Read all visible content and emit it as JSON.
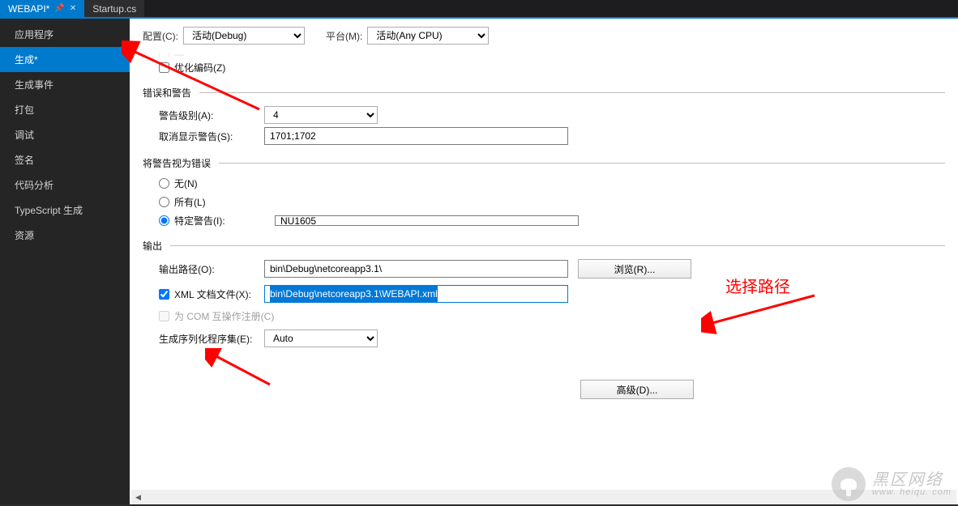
{
  "tabs": {
    "active": {
      "label": "WEBAPI*"
    },
    "inactive": {
      "label": "Startup.cs"
    }
  },
  "sidebar": {
    "items": [
      {
        "label": "应用程序"
      },
      {
        "label": "生成*"
      },
      {
        "label": "生成事件"
      },
      {
        "label": "打包"
      },
      {
        "label": "调试"
      },
      {
        "label": "签名"
      },
      {
        "label": "代码分析"
      },
      {
        "label": "TypeScript 生成"
      },
      {
        "label": "资源"
      }
    ],
    "selected_index": 1
  },
  "topbar": {
    "config_label": "配置(C):",
    "config_value": "活动(Debug)",
    "platform_label": "平台(M):",
    "platform_value": "活动(Any CPU)"
  },
  "general": {
    "optimize_label": "优化编码(Z)"
  },
  "sections": {
    "errors_warnings": "错误和警告",
    "treat_as_errors": "将警告视为错误",
    "output": "输出"
  },
  "warnings": {
    "level_label": "警告级别(A):",
    "level_value": "4",
    "suppress_label": "取消显示警告(S):",
    "suppress_value": "1701;1702"
  },
  "treat": {
    "none": "无(N)",
    "all": "所有(L)",
    "specific": "特定警告(I):",
    "specific_value": "NU1605"
  },
  "output": {
    "path_label": "输出路径(O):",
    "path_value": "bin\\Debug\\netcoreapp3.1\\",
    "browse_btn": "浏览(R)...",
    "xml_label": "XML 文档文件(X):",
    "xml_value": "bin\\Debug\\netcoreapp3.1\\WEBAPI.xml",
    "com_label": "为 COM 互操作注册(C)",
    "serializer_label": "生成序列化程序集(E):",
    "serializer_value": "Auto"
  },
  "advanced_btn": "高级(D)...",
  "annotation": {
    "choose_path": "选择路径"
  },
  "watermark": {
    "cn": "黑区网络",
    "en": "www. heiqu. com"
  }
}
